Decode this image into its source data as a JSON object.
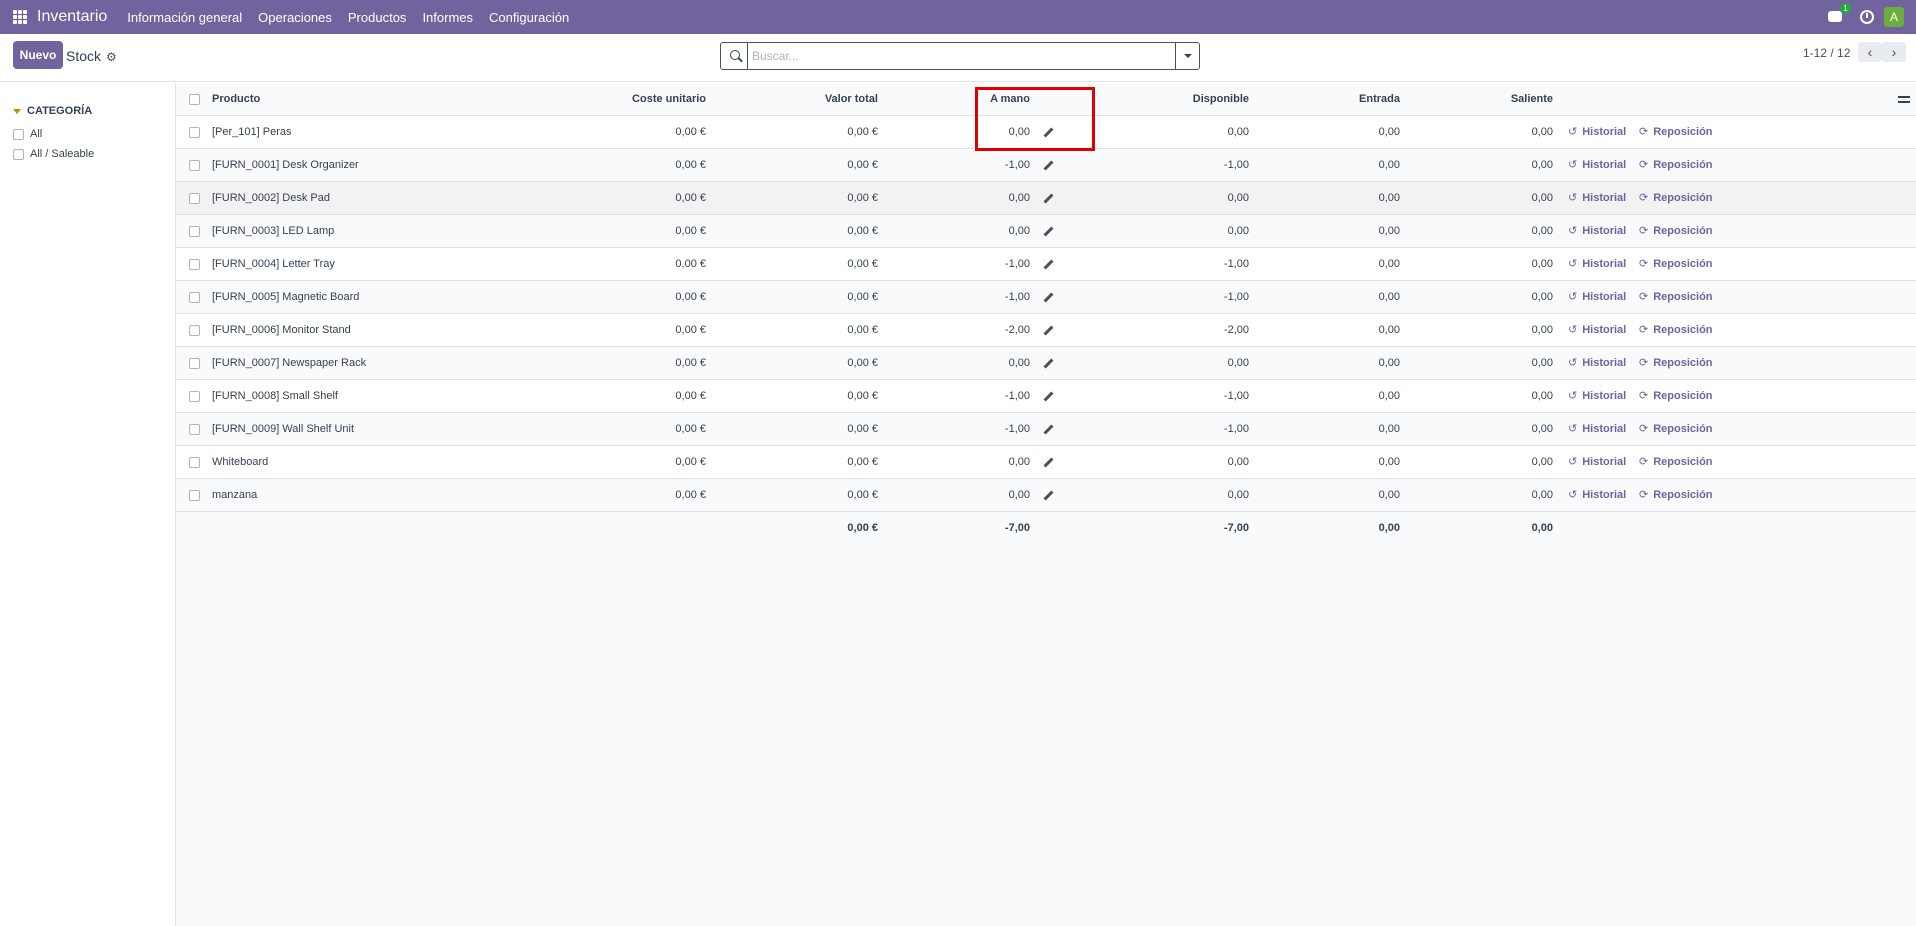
{
  "navbar": {
    "brand": "Inventario",
    "menu": [
      "Información general",
      "Operaciones",
      "Productos",
      "Informes",
      "Configuración"
    ],
    "chat_badge": "1",
    "avatar_letter": "A"
  },
  "control": {
    "new_label": "Nuevo",
    "title": "Stock",
    "search_placeholder": "Buscar...",
    "pager": "1-12 / 12"
  },
  "sidebar": {
    "title": "CATEGORÍA",
    "items": [
      "All",
      "All / Saleable"
    ]
  },
  "table": {
    "headers": {
      "product": "Producto",
      "cost": "Coste unitario",
      "value": "Valor total",
      "on_hand": "A mano",
      "available": "Disponible",
      "incoming": "Entrada",
      "outgoing": "Saliente"
    },
    "action_history": "Historial",
    "action_replenish": "Reposición",
    "rows": [
      {
        "product": "[Per_101] Peras",
        "cost": "0,00 €",
        "value": "0,00 €",
        "on_hand": "0,00",
        "available": "0,00",
        "incoming": "0,00",
        "outgoing": "0,00"
      },
      {
        "product": "[FURN_0001] Desk Organizer",
        "cost": "0,00 €",
        "value": "0,00 €",
        "on_hand": "-1,00",
        "available": "-1,00",
        "incoming": "0,00",
        "outgoing": "0,00"
      },
      {
        "product": "[FURN_0002] Desk Pad",
        "cost": "0,00 €",
        "value": "0,00 €",
        "on_hand": "0,00",
        "available": "0,00",
        "incoming": "0,00",
        "outgoing": "0,00"
      },
      {
        "product": "[FURN_0003] LED Lamp",
        "cost": "0,00 €",
        "value": "0,00 €",
        "on_hand": "0,00",
        "available": "0,00",
        "incoming": "0,00",
        "outgoing": "0,00"
      },
      {
        "product": "[FURN_0004] Letter Tray",
        "cost": "0,00 €",
        "value": "0,00 €",
        "on_hand": "-1,00",
        "available": "-1,00",
        "incoming": "0,00",
        "outgoing": "0,00"
      },
      {
        "product": "[FURN_0005] Magnetic Board",
        "cost": "0,00 €",
        "value": "0,00 €",
        "on_hand": "-1,00",
        "available": "-1,00",
        "incoming": "0,00",
        "outgoing": "0,00"
      },
      {
        "product": "[FURN_0006] Monitor Stand",
        "cost": "0,00 €",
        "value": "0,00 €",
        "on_hand": "-2,00",
        "available": "-2,00",
        "incoming": "0,00",
        "outgoing": "0,00"
      },
      {
        "product": "[FURN_0007] Newspaper Rack",
        "cost": "0,00 €",
        "value": "0,00 €",
        "on_hand": "0,00",
        "available": "0,00",
        "incoming": "0,00",
        "outgoing": "0,00"
      },
      {
        "product": "[FURN_0008] Small Shelf",
        "cost": "0,00 €",
        "value": "0,00 €",
        "on_hand": "-1,00",
        "available": "-1,00",
        "incoming": "0,00",
        "outgoing": "0,00"
      },
      {
        "product": "[FURN_0009] Wall Shelf Unit",
        "cost": "0,00 €",
        "value": "0,00 €",
        "on_hand": "-1,00",
        "available": "-1,00",
        "incoming": "0,00",
        "outgoing": "0,00"
      },
      {
        "product": "Whiteboard",
        "cost": "0,00 €",
        "value": "0,00 €",
        "on_hand": "0,00",
        "available": "0,00",
        "incoming": "0,00",
        "outgoing": "0,00"
      },
      {
        "product": "manzana",
        "cost": "0,00 €",
        "value": "0,00 €",
        "on_hand": "0,00",
        "available": "0,00",
        "incoming": "0,00",
        "outgoing": "0,00"
      }
    ],
    "totals": {
      "value": "0,00 €",
      "on_hand": "-7,00",
      "available": "-7,00",
      "incoming": "0,00",
      "outgoing": "0,00"
    }
  },
  "colors": {
    "brand": "#71639e",
    "highlight": "#e00000"
  }
}
